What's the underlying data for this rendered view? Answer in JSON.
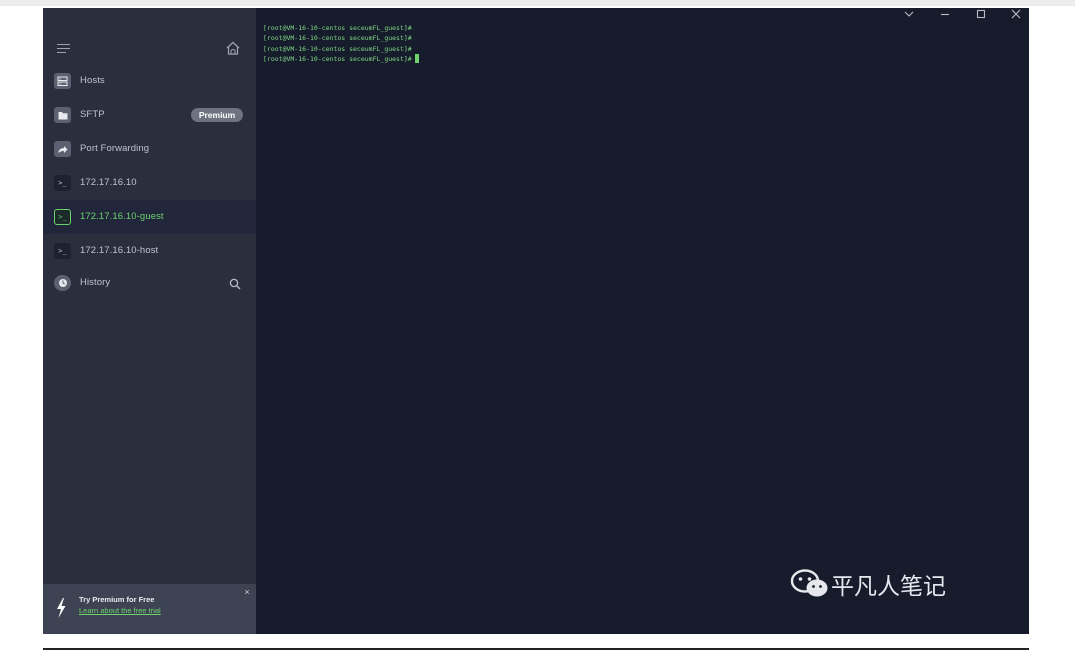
{
  "sidebar": {
    "menu_icon": "hamburger-icon",
    "home_icon": "home-icon",
    "items": [
      {
        "label": "Hosts",
        "icon": "server-icon"
      },
      {
        "label": "SFTP",
        "icon": "folder-icon",
        "badge": "Premium"
      },
      {
        "label": "Port Forwarding",
        "icon": "arrow-forward-icon"
      },
      {
        "label": "172.17.16.10",
        "icon": "terminal-icon"
      },
      {
        "label": "172.17.16.10-guest",
        "icon": "terminal-icon",
        "active": true
      },
      {
        "label": "172.17.16.10-host",
        "icon": "terminal-icon"
      },
      {
        "label": "History",
        "icon": "clock-icon"
      }
    ],
    "history_search_icon": "search-icon"
  },
  "promo": {
    "title": "Try Premium for Free",
    "link": "Learn about the free trial",
    "close": "×"
  },
  "terminal": {
    "lines": [
      "[root@VM-16-10-centos seceumFL_guest]#",
      "[root@VM-16-10-centos seceumFL_guest]#",
      "[root@VM-16-10-centos seceumFL_guest]#",
      "[root@VM-16-10-centos seceumFL_guest]#"
    ]
  },
  "window_controls": [
    "chevron-down-icon",
    "minimize-icon",
    "maximize-icon",
    "close-icon"
  ],
  "watermark": {
    "text": "平凡人笔记",
    "icon": "wechat-icon"
  },
  "colors": {
    "accent": "#6dd36f",
    "sidebar_bg": "#2b2f3d",
    "terminal_bg": "#171c2c",
    "active_item_bg": "#21263a",
    "promo_bg": "#3d4352",
    "badge_bg": "#6e7381"
  }
}
